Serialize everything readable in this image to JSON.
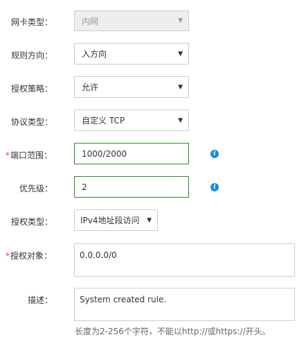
{
  "form": {
    "nic_type": {
      "label": "网卡类型：",
      "value": "内网"
    },
    "rule_direction": {
      "label": "规则方向：",
      "value": "入方向"
    },
    "auth_policy": {
      "label": "授权策略：",
      "value": "允许"
    },
    "protocol_type": {
      "label": "协议类型：",
      "value": "自定义 TCP"
    },
    "port_range": {
      "required_mark": "*",
      "label": "端口范围：",
      "value": "1000/2000",
      "info_icon": "info-icon"
    },
    "priority": {
      "label": "优先级：",
      "value": "2",
      "info_icon": "info-icon"
    },
    "auth_type": {
      "label": "授权类型：",
      "value": "IPv4地址段访问"
    },
    "auth_object": {
      "required_mark": "*",
      "label": "授权对象：",
      "value": "0.0.0.0/0"
    },
    "description": {
      "label": "描述：",
      "value": "System created rule.",
      "hint": "长度为2-256个字符，不能以http://或https://开头。"
    },
    "dropdown_glyph": "▼",
    "info_glyph": "i"
  },
  "colors": {
    "valid_border": "#2e8b2e",
    "info_icon": "#1e88e5",
    "required": "#e4393c",
    "disabled_bg": "#eeeeee"
  }
}
